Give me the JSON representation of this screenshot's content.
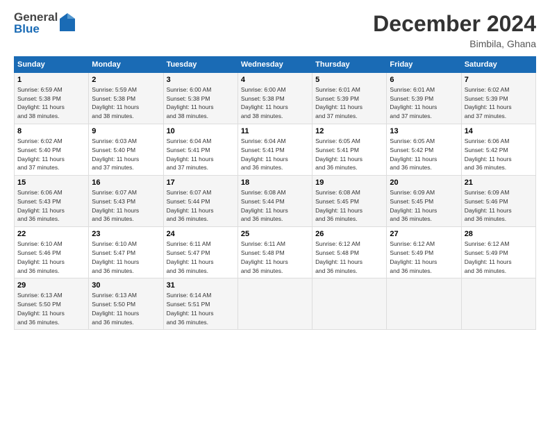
{
  "logo": {
    "general": "General",
    "blue": "Blue"
  },
  "header": {
    "month": "December 2024",
    "location": "Bimbila, Ghana"
  },
  "weekdays": [
    "Sunday",
    "Monday",
    "Tuesday",
    "Wednesday",
    "Thursday",
    "Friday",
    "Saturday"
  ],
  "weeks": [
    [
      {
        "day": "1",
        "sunrise": "6:59 AM",
        "sunset": "5:38 PM",
        "daylight": "11 hours",
        "minutes": "38"
      },
      {
        "day": "2",
        "sunrise": "5:59 AM",
        "sunset": "5:38 PM",
        "daylight": "11 hours",
        "minutes": "38"
      },
      {
        "day": "3",
        "sunrise": "6:00 AM",
        "sunset": "5:38 PM",
        "daylight": "11 hours",
        "minutes": "38"
      },
      {
        "day": "4",
        "sunrise": "6:00 AM",
        "sunset": "5:38 PM",
        "daylight": "11 hours",
        "minutes": "38"
      },
      {
        "day": "5",
        "sunrise": "6:01 AM",
        "sunset": "5:39 PM",
        "daylight": "11 hours",
        "minutes": "37"
      },
      {
        "day": "6",
        "sunrise": "6:01 AM",
        "sunset": "5:39 PM",
        "daylight": "11 hours",
        "minutes": "37"
      },
      {
        "day": "7",
        "sunrise": "6:02 AM",
        "sunset": "5:39 PM",
        "daylight": "11 hours",
        "minutes": "37"
      }
    ],
    [
      {
        "day": "8",
        "sunrise": "6:02 AM",
        "sunset": "5:40 PM",
        "daylight": "11 hours",
        "minutes": "37"
      },
      {
        "day": "9",
        "sunrise": "6:03 AM",
        "sunset": "5:40 PM",
        "daylight": "11 hours",
        "minutes": "37"
      },
      {
        "day": "10",
        "sunrise": "6:04 AM",
        "sunset": "5:41 PM",
        "daylight": "11 hours",
        "minutes": "37"
      },
      {
        "day": "11",
        "sunrise": "6:04 AM",
        "sunset": "5:41 PM",
        "daylight": "11 hours",
        "minutes": "36"
      },
      {
        "day": "12",
        "sunrise": "6:05 AM",
        "sunset": "5:41 PM",
        "daylight": "11 hours",
        "minutes": "36"
      },
      {
        "day": "13",
        "sunrise": "6:05 AM",
        "sunset": "5:42 PM",
        "daylight": "11 hours",
        "minutes": "36"
      },
      {
        "day": "14",
        "sunrise": "6:06 AM",
        "sunset": "5:42 PM",
        "daylight": "11 hours",
        "minutes": "36"
      }
    ],
    [
      {
        "day": "15",
        "sunrise": "6:06 AM",
        "sunset": "5:43 PM",
        "daylight": "11 hours",
        "minutes": "36"
      },
      {
        "day": "16",
        "sunrise": "6:07 AM",
        "sunset": "5:43 PM",
        "daylight": "11 hours",
        "minutes": "36"
      },
      {
        "day": "17",
        "sunrise": "6:07 AM",
        "sunset": "5:44 PM",
        "daylight": "11 hours",
        "minutes": "36"
      },
      {
        "day": "18",
        "sunrise": "6:08 AM",
        "sunset": "5:44 PM",
        "daylight": "11 hours",
        "minutes": "36"
      },
      {
        "day": "19",
        "sunrise": "6:08 AM",
        "sunset": "5:45 PM",
        "daylight": "11 hours",
        "minutes": "36"
      },
      {
        "day": "20",
        "sunrise": "6:09 AM",
        "sunset": "5:45 PM",
        "daylight": "11 hours",
        "minutes": "36"
      },
      {
        "day": "21",
        "sunrise": "6:09 AM",
        "sunset": "5:46 PM",
        "daylight": "11 hours",
        "minutes": "36"
      }
    ],
    [
      {
        "day": "22",
        "sunrise": "6:10 AM",
        "sunset": "5:46 PM",
        "daylight": "11 hours",
        "minutes": "36"
      },
      {
        "day": "23",
        "sunrise": "6:10 AM",
        "sunset": "5:47 PM",
        "daylight": "11 hours",
        "minutes": "36"
      },
      {
        "day": "24",
        "sunrise": "6:11 AM",
        "sunset": "5:47 PM",
        "daylight": "11 hours",
        "minutes": "36"
      },
      {
        "day": "25",
        "sunrise": "6:11 AM",
        "sunset": "5:48 PM",
        "daylight": "11 hours",
        "minutes": "36"
      },
      {
        "day": "26",
        "sunrise": "6:12 AM",
        "sunset": "5:48 PM",
        "daylight": "11 hours",
        "minutes": "36"
      },
      {
        "day": "27",
        "sunrise": "6:12 AM",
        "sunset": "5:49 PM",
        "daylight": "11 hours",
        "minutes": "36"
      },
      {
        "day": "28",
        "sunrise": "6:12 AM",
        "sunset": "5:49 PM",
        "daylight": "11 hours",
        "minutes": "36"
      }
    ],
    [
      {
        "day": "29",
        "sunrise": "6:13 AM",
        "sunset": "5:50 PM",
        "daylight": "11 hours",
        "minutes": "36"
      },
      {
        "day": "30",
        "sunrise": "6:13 AM",
        "sunset": "5:50 PM",
        "daylight": "11 hours",
        "minutes": "36"
      },
      {
        "day": "31",
        "sunrise": "6:14 AM",
        "sunset": "5:51 PM",
        "daylight": "11 hours",
        "minutes": "36"
      },
      null,
      null,
      null,
      null
    ]
  ],
  "labels": {
    "sunrise": "Sunrise:",
    "sunset": "Sunset:",
    "daylight": "Daylight: "
  }
}
